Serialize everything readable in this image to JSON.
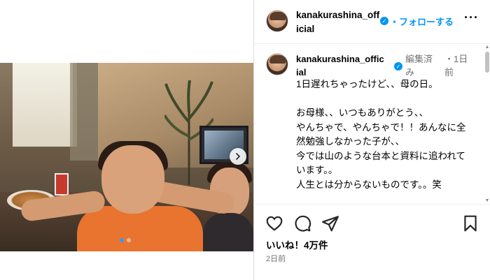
{
  "post": {
    "author": "kanakurashina_official",
    "follow_label": "フォローする",
    "follow_separator": "・",
    "more_label": "···",
    "edited_label": "編集済み",
    "caption_separator": "・",
    "caption_time": "1日前",
    "caption": "1日遅れちゃったけど、、母の日。\n\nお母様、、いつもありがとう、、\nやんちゃで、やんちゃで！！あんなに全然勉強しなかった子が、、\n今では山のような台本と資料に追われています。。\n人生とは分からないものです。。笑\n\n今度みんなで海外旅行にでも行きましょ",
    "likes": "いいね！4万件",
    "posted_ago": "2日前"
  },
  "carousel": {
    "slide_count": 2,
    "active_slide": 1
  },
  "icons": {
    "verified": "verified-badge-icon",
    "next": "chevron-right-icon",
    "like": "heart-icon",
    "comment": "comment-bubble-icon",
    "share": "paper-plane-icon",
    "save": "bookmark-icon"
  },
  "colors": {
    "accent": "#0095f6",
    "muted": "#737373",
    "carousel_active_dot": "#3897f0"
  }
}
